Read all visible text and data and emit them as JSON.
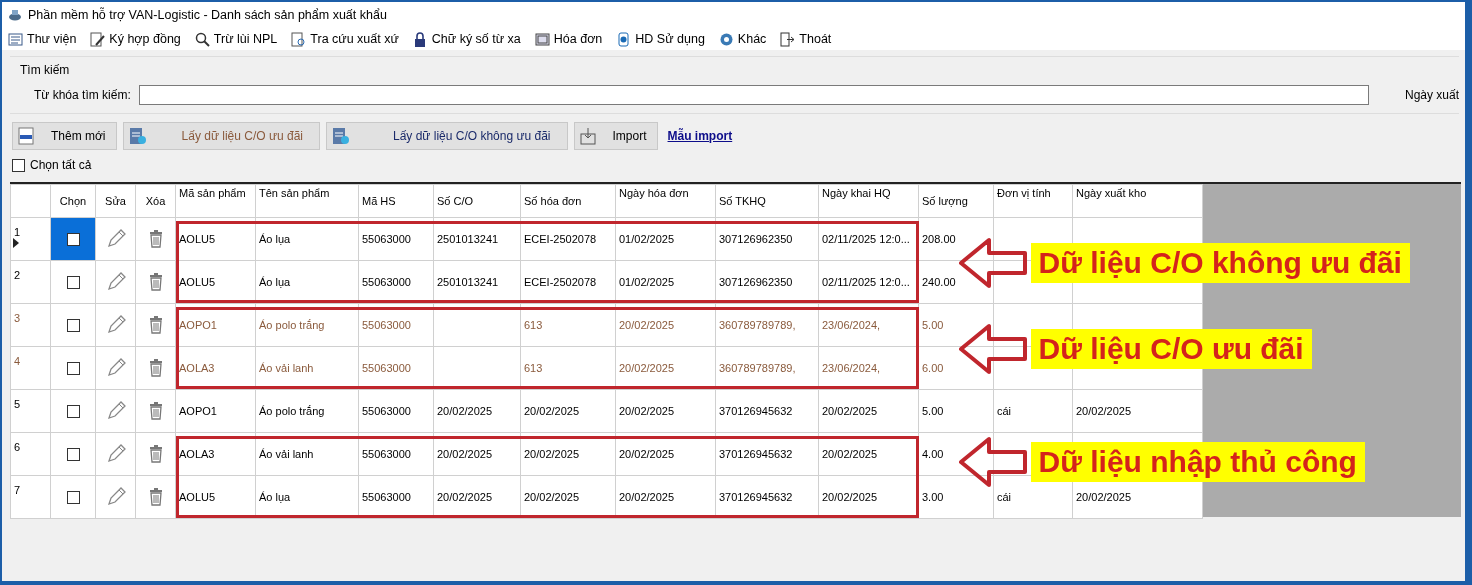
{
  "window": {
    "title": "Phần mềm hỗ trợ VAN-Logistic - Danh sách sản phẩm xuất khẩu"
  },
  "toolbar": [
    {
      "label": "Thư viện",
      "kind": "library"
    },
    {
      "label": "Ký hợp đồng",
      "kind": "sign"
    },
    {
      "label": "Trừ lùi NPL",
      "kind": "search"
    },
    {
      "label": "Tra cứu xuất xứ",
      "kind": "lookup"
    },
    {
      "label": "Chữ ký số từ xa",
      "kind": "lock"
    },
    {
      "label": "Hóa đơn",
      "kind": "invoice"
    },
    {
      "label": "HD Sử dụng",
      "kind": "info"
    },
    {
      "label": "Khác",
      "kind": "gear"
    },
    {
      "label": "Thoát",
      "kind": "exit"
    }
  ],
  "search": {
    "group_title": "Tìm kiếm",
    "keyword_label": "Từ khóa tìm kiếm:",
    "date_label": "Ngày xuất"
  },
  "actions": [
    {
      "label": "Thêm mới",
      "kind": "new",
      "color": "#000000"
    },
    {
      "label": "Lấy dữ liệu C/O ưu đãi",
      "kind": "doc",
      "color": "#8a5a3c"
    },
    {
      "label": "Lấy dữ liệu C/O không ưu đãi",
      "kind": "doc",
      "color": "#1a2a6a"
    },
    {
      "label": "Import",
      "kind": "import",
      "color": "#000000"
    }
  ],
  "import_link": "Mẫu import",
  "select_all": {
    "label": "Chọn tất cả",
    "checked": false
  },
  "table": {
    "columns": [
      "Chọn",
      "Sửa",
      "Xóa",
      "Mã sản phẩm",
      "Tên sản phẩm",
      "Mã HS",
      "Số C/O",
      "Số hóa đơn",
      "Ngày hóa đơn",
      "Số TKHQ",
      "Ngày khai HQ",
      "Số lượng",
      "Đơn vị tính",
      "Ngày xuất kho"
    ],
    "groups": [
      {
        "annotation": "Dữ liệu C/O không ưu đãi",
        "rows": [
          {
            "number": "1",
            "selected": true,
            "checked": false,
            "kind": "normal",
            "cells": [
              "AOLU5",
              "Áo lụa",
              "55063000",
              "2501013241",
              "ECEI-2502078",
              "01/02/2025",
              "307126962350",
              "02/11/2025 12:0...",
              "208.00",
              "",
              ""
            ]
          },
          {
            "number": "2",
            "selected": false,
            "checked": false,
            "kind": "normal",
            "cells": [
              "AOLU5",
              "Áo lụa",
              "55063000",
              "2501013241",
              "ECEI-2502078",
              "01/02/2025",
              "307126962350",
              "02/11/2025 12:0...",
              "240.00",
              "",
              ""
            ]
          }
        ]
      },
      {
        "annotation": "Dữ liệu C/O ưu đãi",
        "rows": [
          {
            "number": "3",
            "selected": false,
            "checked": false,
            "kind": "muted",
            "cells": [
              "AOPO1",
              "Áo polo trắng",
              "55063000",
              "",
              "613",
              "20/02/2025",
              "360789789789,",
              "23/06/2024,",
              "5.00",
              "",
              ""
            ]
          },
          {
            "number": "4",
            "selected": false,
            "checked": false,
            "kind": "muted",
            "cells": [
              "AOLA3",
              "Áo vải lanh",
              "55063000",
              "",
              "613",
              "20/02/2025",
              "360789789789,",
              "23/06/2024,",
              "6.00",
              "",
              ""
            ]
          }
        ]
      },
      {
        "rows": [
          {
            "number": "5",
            "selected": false,
            "checked": false,
            "kind": "normal",
            "cells": [
              "AOPO1",
              "Áo polo trắng",
              "55063000",
              "20/02/2025",
              "20/02/2025",
              "20/02/2025",
              "370126945632",
              "20/02/2025",
              "5.00",
              "cái",
              "20/02/2025"
            ]
          }
        ]
      },
      {
        "annotation": "Dữ liệu nhập thủ công",
        "rows": [
          {
            "number": "6",
            "selected": false,
            "checked": false,
            "kind": "normal",
            "cells": [
              "AOLA3",
              "Áo vải lanh",
              "55063000",
              "20/02/2025",
              "20/02/2025",
              "20/02/2025",
              "370126945632",
              "20/02/2025",
              "4.00",
              "",
              ""
            ]
          },
          {
            "number": "7",
            "selected": false,
            "checked": false,
            "kind": "normal",
            "cells": [
              "AOLU5",
              "Áo lụa",
              "55063000",
              "20/02/2025",
              "20/02/2025",
              "20/02/2025",
              "370126945632",
              "20/02/2025",
              "3.00",
              "cái",
              "20/02/2025"
            ]
          }
        ]
      }
    ]
  }
}
